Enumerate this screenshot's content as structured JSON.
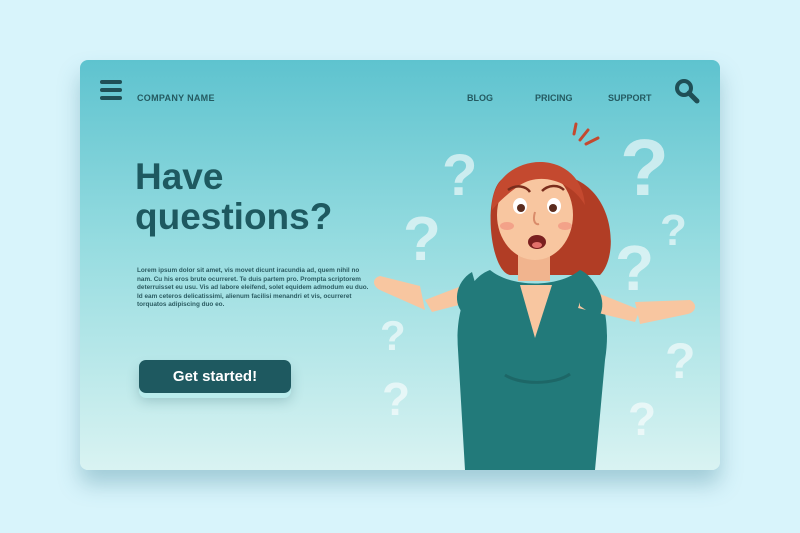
{
  "header": {
    "company_name": "COMPANY NAME",
    "nav": [
      "BLOG",
      "PRICING",
      "SUPPORT"
    ],
    "menu_icon": "hamburger-menu-icon",
    "search_icon": "search-icon"
  },
  "hero": {
    "headline_line1": "Have",
    "headline_line2": "questions?",
    "body": "Lorem ipsum dolor sit amet, vis movet dicunt iracundia ad, quem nihil no nam. Cu his eros brute ocurreret. Te duis partem pro. Prompta scriptorem deterruisset eu usu. Vis ad labore eleifend, solet equidem admodum eu duo. Id eam ceteros delicatissimi, alienum facilisi menandri et vis, ocurreret torquatos adipiscing duo eo.",
    "cta_label": "Get started!"
  },
  "colors": {
    "page_bg": "#d8f4fb",
    "card_top": "#5ec3cf",
    "card_bottom": "#d9f3f2",
    "primary": "#1e5960",
    "hair": "#c4492f",
    "dress": "#227a7a",
    "skin": "#f8c6a0"
  },
  "illustration": {
    "subject": "confused woman shrugging",
    "decorations": "question-mark-icons"
  }
}
